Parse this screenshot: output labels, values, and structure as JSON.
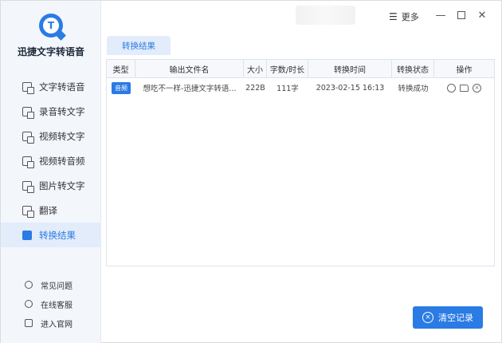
{
  "app": {
    "title": "迅捷文字转语音",
    "logo_letter": "T"
  },
  "sidebar": {
    "items": [
      {
        "label": "文字转语音",
        "icon": "text-to-speech-icon"
      },
      {
        "label": "录音转文字",
        "icon": "recording-to-text-icon"
      },
      {
        "label": "视频转文字",
        "icon": "video-to-text-icon"
      },
      {
        "label": "视频转音频",
        "icon": "video-to-audio-icon"
      },
      {
        "label": "图片转文字",
        "icon": "image-to-text-icon"
      },
      {
        "label": "翻译",
        "icon": "translate-icon"
      },
      {
        "label": "转换结果",
        "icon": "results-icon",
        "active": true
      }
    ],
    "footer": [
      {
        "label": "常见问题",
        "icon": "question-icon"
      },
      {
        "label": "在线客服",
        "icon": "headset-icon"
      },
      {
        "label": "进入官网",
        "icon": "monitor-icon"
      }
    ]
  },
  "titlebar": {
    "more_label": "更多",
    "more_glyph": "☰",
    "minimize_glyph": "—",
    "close_glyph": "✕"
  },
  "tab": {
    "label": "转换结果"
  },
  "table": {
    "headers": [
      "类型",
      "输出文件名",
      "大小",
      "字数/时长",
      "转换时间",
      "转换状态",
      "操作"
    ],
    "rows": [
      {
        "type": "音频",
        "filename": "想吃不一样-迅捷文字转语...",
        "size": "222B",
        "length": "111字",
        "time": "2023-02-15 16:13",
        "status": "转换成功"
      }
    ]
  },
  "clear_button": {
    "label": "清空记录",
    "icon_glyph": "×"
  },
  "colors": {
    "accent": "#2a7be4",
    "sidebar_bg": "#f3f6fb"
  }
}
